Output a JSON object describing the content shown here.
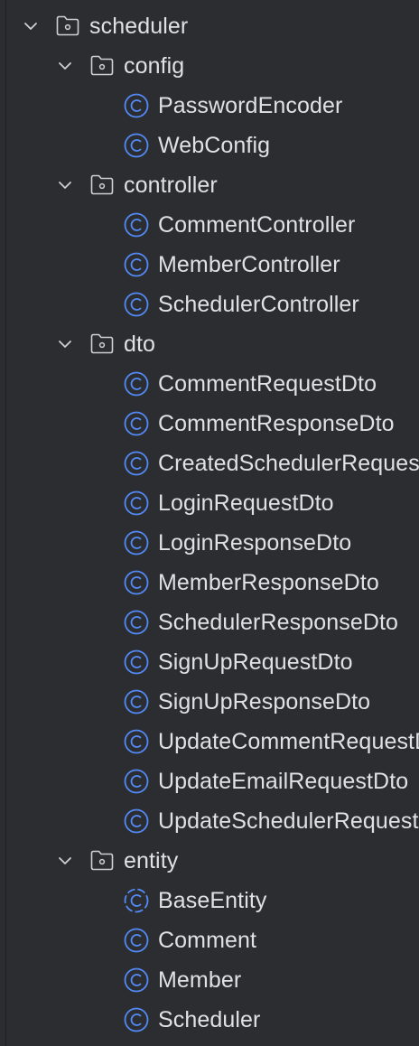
{
  "tree": {
    "root": {
      "label": "scheduler",
      "icon": "folder-package-icon",
      "expanded": true
    },
    "packages": [
      {
        "label": "config",
        "expanded": true,
        "classes": [
          {
            "label": "PasswordEncoder",
            "icon": "class-icon"
          },
          {
            "label": "WebConfig",
            "icon": "class-icon"
          }
        ]
      },
      {
        "label": "controller",
        "expanded": true,
        "classes": [
          {
            "label": "CommentController",
            "icon": "class-icon"
          },
          {
            "label": "MemberController",
            "icon": "class-icon"
          },
          {
            "label": "SchedulerController",
            "icon": "class-icon"
          }
        ]
      },
      {
        "label": "dto",
        "expanded": true,
        "classes": [
          {
            "label": "CommentRequestDto",
            "icon": "class-icon"
          },
          {
            "label": "CommentResponseDto",
            "icon": "class-icon"
          },
          {
            "label": "CreatedSchedulerRequestDto",
            "icon": "class-icon"
          },
          {
            "label": "LoginRequestDto",
            "icon": "class-icon"
          },
          {
            "label": "LoginResponseDto",
            "icon": "class-icon"
          },
          {
            "label": "MemberResponseDto",
            "icon": "class-icon"
          },
          {
            "label": "SchedulerResponseDto",
            "icon": "class-icon"
          },
          {
            "label": "SignUpRequestDto",
            "icon": "class-icon"
          },
          {
            "label": "SignUpResponseDto",
            "icon": "class-icon"
          },
          {
            "label": "UpdateCommentRequestDto",
            "icon": "class-icon"
          },
          {
            "label": "UpdateEmailRequestDto",
            "icon": "class-icon"
          },
          {
            "label": "UpdateSchedulerRequestDto",
            "icon": "class-icon"
          }
        ]
      },
      {
        "label": "entity",
        "expanded": true,
        "classes": [
          {
            "label": "BaseEntity",
            "icon": "abstract-class-icon"
          },
          {
            "label": "Comment",
            "icon": "class-icon"
          },
          {
            "label": "Member",
            "icon": "class-icon"
          },
          {
            "label": "Scheduler",
            "icon": "class-icon"
          }
        ]
      }
    ]
  },
  "colors": {
    "background": "#2b2d30",
    "text": "#dfe1e5",
    "class_icon": "#548af7",
    "folder_icon": "#ced0d6",
    "chevron": "#ced0d6"
  }
}
